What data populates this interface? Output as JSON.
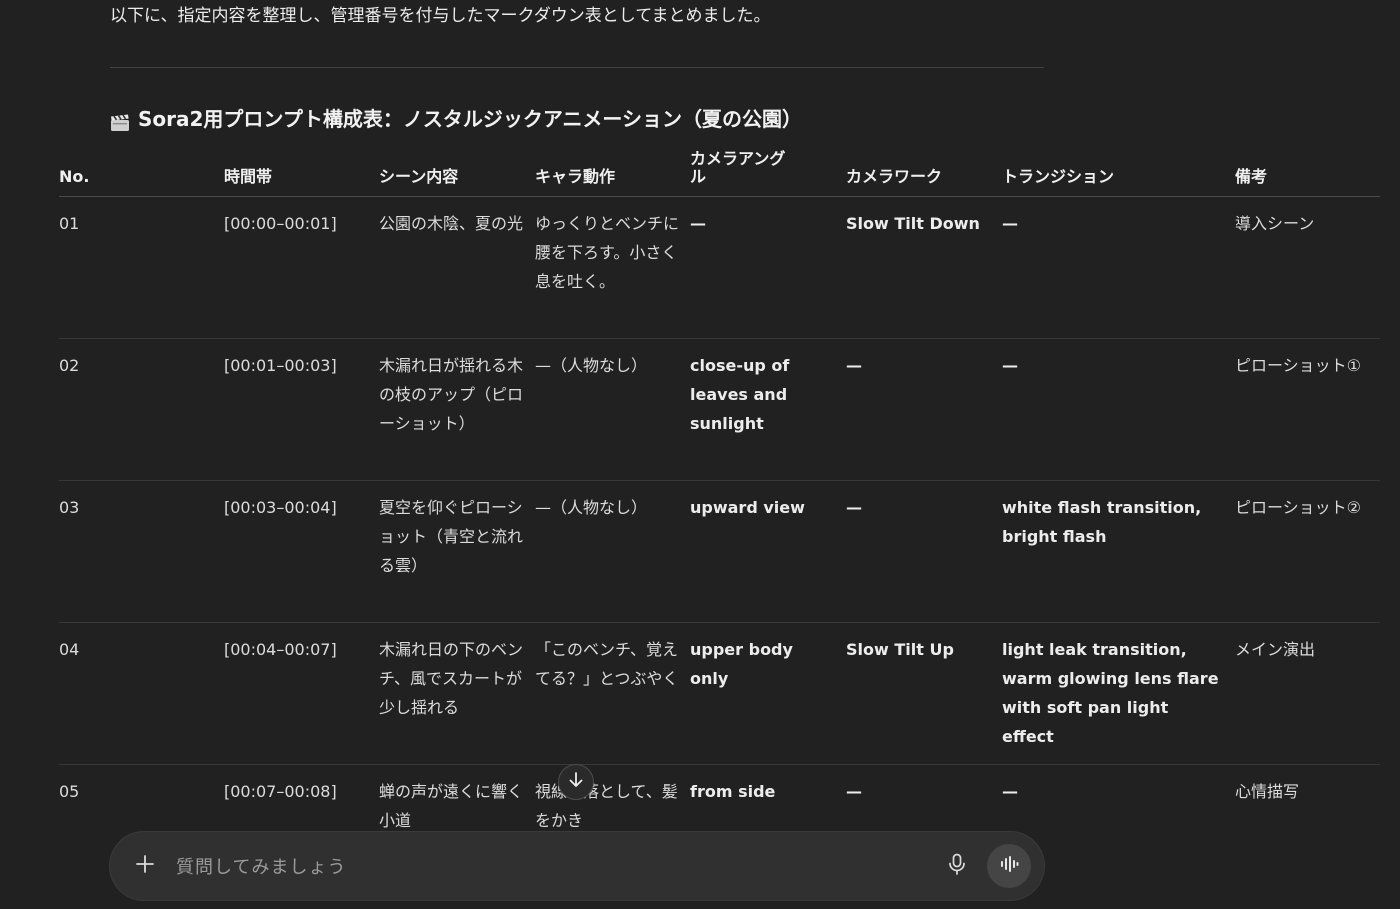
{
  "message": {
    "intro": "以下に、指定内容を整理し、管理番号を付与したマークダウン表としてまとめました。",
    "heading": "Sora2用プロンプト構成表：ノスタルジックアニメーション（夏の公園）",
    "heading_icon": "clapper-board-icon"
  },
  "table": {
    "headers": {
      "no": "No.",
      "time": "時間帯",
      "scene": "シーン内容",
      "action": "キャラ動作",
      "angle": "カメラアングル",
      "work": "カメラワーク",
      "transition": "トランジション",
      "note": "備考"
    },
    "rows": [
      {
        "no": "01",
        "time": "[00:00–00:01]",
        "scene": "公園の木陰、夏の光",
        "action": "ゆっくりとベンチに腰を下ろす。小さく息を吐く。",
        "angle": "—",
        "work": "Slow Tilt Down",
        "transition": "—",
        "note": "導入シーン"
      },
      {
        "no": "02",
        "time": "[00:01–00:03]",
        "scene": "木漏れ日が揺れる木の枝のアップ（ピローショット）",
        "action": "—（人物なし）",
        "angle": "close-up of leaves and sunlight",
        "work": "—",
        "transition": "—",
        "note": "ピローショット①"
      },
      {
        "no": "03",
        "time": "[00:03–00:04]",
        "scene": "夏空を仰ぐピローショット（青空と流れる雲）",
        "action": "—（人物なし）",
        "angle": "upward view",
        "work": "—",
        "transition": "white flash transition, bright flash",
        "note": "ピローショット②"
      },
      {
        "no": "04",
        "time": "[00:04–00:07]",
        "scene": "木漏れ日の下のベンチ、風でスカートが少し揺れる",
        "action": "「このベンチ、覚えてる？」とつぶやく",
        "angle": "upper body only",
        "work": "Slow Tilt Up",
        "transition": "light leak transition, warm glowing lens flare with soft pan light effect",
        "note": "メイン演出"
      },
      {
        "no": "05",
        "time": "[00:07–00:08]",
        "scene": "蝉の声が遠くに響く小道",
        "action": "視線を落として、髪をかき",
        "angle": "from side",
        "work": "—",
        "transition": "—",
        "note": "心情描写"
      }
    ]
  },
  "composer": {
    "placeholder": "質問してみましょう",
    "plus_icon": "plus-icon",
    "mic_icon": "microphone-icon",
    "voice_icon": "voice-mode-icon"
  },
  "scroll": {
    "icon": "arrow-down-icon"
  }
}
